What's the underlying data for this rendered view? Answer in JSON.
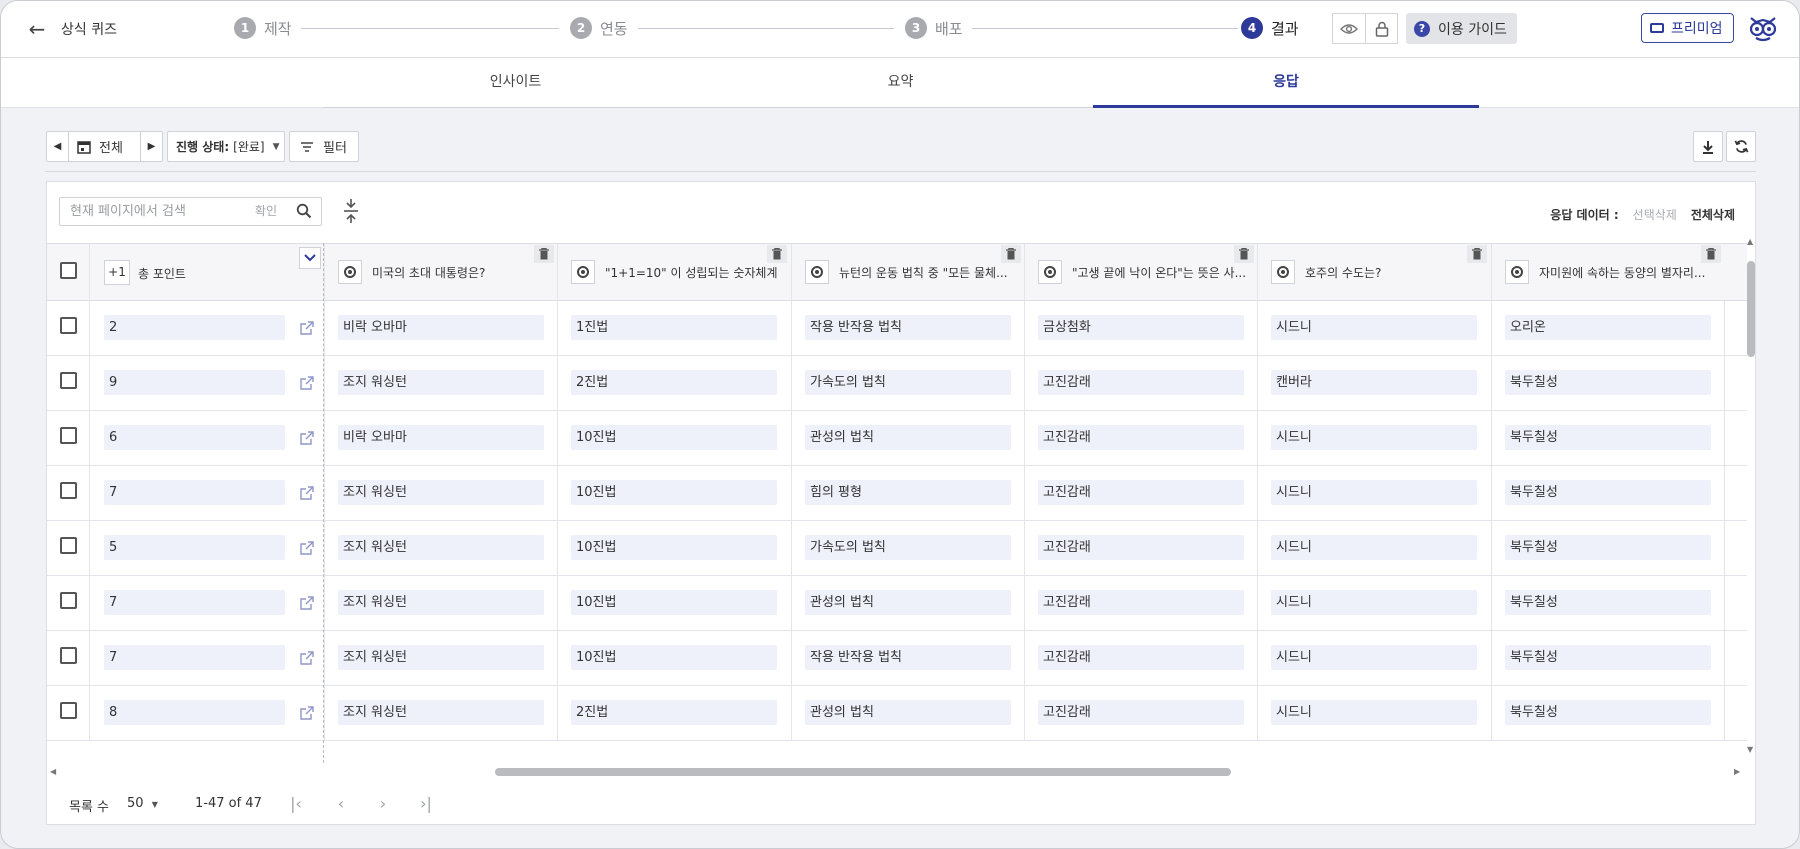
{
  "header": {
    "title": "상식 퀴즈",
    "steps": [
      {
        "num": "1",
        "label": "제작"
      },
      {
        "num": "2",
        "label": "연동"
      },
      {
        "num": "3",
        "label": "배포"
      },
      {
        "num": "4",
        "label": "결과"
      }
    ],
    "guide_label": "이용 가이드",
    "premium_label": "프리미엄",
    "accent": "#2d3a9a"
  },
  "tabs": [
    {
      "label": "인사이트"
    },
    {
      "label": "요약"
    },
    {
      "label": "응답",
      "active": true
    }
  ],
  "toolbar": {
    "date_label": "전체",
    "status_key": "진행 상태:",
    "status_value": "[완료]",
    "filter_label": "필터"
  },
  "search": {
    "placeholder": "현재 페이지에서 검색",
    "confirm": "확인"
  },
  "response_data": {
    "label": "응답 데이터 :",
    "delete_selected": "선택삭제",
    "delete_all": "전체삭제"
  },
  "table": {
    "add_button": "+1",
    "total_points_label": "총 포인트",
    "questions": [
      "미국의 초대 대통령은?",
      "\"1+1=10\" 이 성립되는 숫자체계...",
      "뉴턴의 운동 법칙 중 \"모든 물체...",
      "\"고생 끝에 낙이 온다\"는 뜻은 사...",
      "호주의 수도는?",
      "자미원에 속하는 동양의 별자리..."
    ],
    "rows": [
      {
        "points": "2",
        "answers": [
          "비락 오바마",
          "1진법",
          "작용 반작용 법칙",
          "금상첨화",
          "시드니",
          "오리온"
        ]
      },
      {
        "points": "9",
        "answers": [
          "조지 워싱턴",
          "2진법",
          "가속도의 법칙",
          "고진감래",
          "캔버라",
          "북두칠성"
        ]
      },
      {
        "points": "6",
        "answers": [
          "비락 오바마",
          "10진법",
          "관성의 법칙",
          "고진감래",
          "시드니",
          "북두칠성"
        ]
      },
      {
        "points": "7",
        "answers": [
          "조지 워싱턴",
          "10진법",
          "힘의 평형",
          "고진감래",
          "시드니",
          "북두칠성"
        ]
      },
      {
        "points": "5",
        "answers": [
          "조지 워싱턴",
          "10진법",
          "가속도의 법칙",
          "고진감래",
          "시드니",
          "북두칠성"
        ]
      },
      {
        "points": "7",
        "answers": [
          "조지 워싱턴",
          "10진법",
          "관성의 법칙",
          "고진감래",
          "시드니",
          "북두칠성"
        ]
      },
      {
        "points": "7",
        "answers": [
          "조지 워싱턴",
          "10진법",
          "작용 반작용 법칙",
          "고진감래",
          "시드니",
          "북두칠성"
        ]
      },
      {
        "points": "8",
        "answers": [
          "조지 워싱턴",
          "2진법",
          "관성의 법칙",
          "고진감래",
          "시드니",
          "북두칠성"
        ]
      }
    ]
  },
  "footer": {
    "rows_label": "목록 수",
    "page_size": "50",
    "range": "1-47 of 47"
  }
}
